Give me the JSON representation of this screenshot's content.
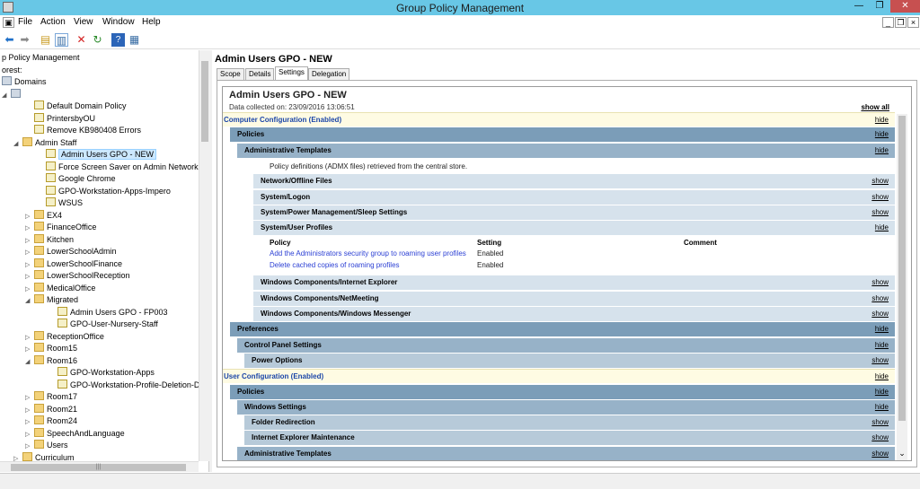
{
  "window": {
    "title": "Group Policy Management"
  },
  "menu": [
    "File",
    "Action",
    "View",
    "Window",
    "Help"
  ],
  "tree": {
    "nodes": [
      {
        "label": "p Policy Management",
        "indent": 0,
        "icon": "none",
        "exp": ""
      },
      {
        "label": "orest:",
        "indent": 0,
        "icon": "none",
        "exp": ""
      },
      {
        "label": "Domains",
        "indent": 0,
        "icon": "domain",
        "exp": ""
      },
      {
        "label": "",
        "indent": 0,
        "icon": "domain",
        "exp": "◢"
      },
      {
        "label": "Default Domain Policy",
        "indent": 2,
        "icon": "gpo",
        "exp": ""
      },
      {
        "label": "PrintersbyOU",
        "indent": 2,
        "icon": "gpo",
        "exp": ""
      },
      {
        "label": "Remove KB980408 Errors",
        "indent": 2,
        "icon": "gpo",
        "exp": ""
      },
      {
        "label": "Admin Staff",
        "indent": 1,
        "icon": "folder",
        "exp": "◢"
      },
      {
        "label": "Admin Users GPO - NEW",
        "indent": 3,
        "icon": "gpo",
        "exp": "",
        "selected": true
      },
      {
        "label": "Force Screen Saver on Admin Network",
        "indent": 3,
        "icon": "gpo",
        "exp": ""
      },
      {
        "label": "Google Chrome",
        "indent": 3,
        "icon": "gpo",
        "exp": ""
      },
      {
        "label": "GPO-Workstation-Apps-Impero",
        "indent": 3,
        "icon": "gpo",
        "exp": ""
      },
      {
        "label": "WSUS",
        "indent": 3,
        "icon": "gpo",
        "exp": ""
      },
      {
        "label": "EX4",
        "indent": 2,
        "icon": "folder",
        "exp": "▷"
      },
      {
        "label": "FinanceOffice",
        "indent": 2,
        "icon": "folder",
        "exp": "▷"
      },
      {
        "label": "Kitchen",
        "indent": 2,
        "icon": "folder",
        "exp": "▷"
      },
      {
        "label": "LowerSchoolAdmin",
        "indent": 2,
        "icon": "folder",
        "exp": "▷"
      },
      {
        "label": "LowerSchoolFinance",
        "indent": 2,
        "icon": "folder",
        "exp": "▷"
      },
      {
        "label": "LowerSchoolReception",
        "indent": 2,
        "icon": "folder",
        "exp": "▷"
      },
      {
        "label": "MedicalOffice",
        "indent": 2,
        "icon": "folder",
        "exp": "▷"
      },
      {
        "label": "Migrated",
        "indent": 2,
        "icon": "folder",
        "exp": "◢"
      },
      {
        "label": "Admin Users GPO - FP003",
        "indent": 4,
        "icon": "gpo",
        "exp": ""
      },
      {
        "label": "GPO-User-Nursery-Staff",
        "indent": 4,
        "icon": "gpo",
        "exp": ""
      },
      {
        "label": "ReceptionOffice",
        "indent": 2,
        "icon": "folder",
        "exp": "▷"
      },
      {
        "label": "Room15",
        "indent": 2,
        "icon": "folder",
        "exp": "▷"
      },
      {
        "label": "Room16",
        "indent": 2,
        "icon": "folder",
        "exp": "◢"
      },
      {
        "label": "GPO-Workstation-Apps",
        "indent": 4,
        "icon": "gpo",
        "exp": ""
      },
      {
        "label": "GPO-Workstation-Profile-Deletion-Dis",
        "indent": 4,
        "icon": "gpo",
        "exp": ""
      },
      {
        "label": "Room17",
        "indent": 2,
        "icon": "folder",
        "exp": "▷"
      },
      {
        "label": "Room21",
        "indent": 2,
        "icon": "folder",
        "exp": "▷"
      },
      {
        "label": "Room24",
        "indent": 2,
        "icon": "folder",
        "exp": "▷"
      },
      {
        "label": "SpeechAndLanguage",
        "indent": 2,
        "icon": "folder",
        "exp": "▷"
      },
      {
        "label": "Users",
        "indent": 2,
        "icon": "folder",
        "exp": "▷"
      },
      {
        "label": "Curriculum",
        "indent": 1,
        "icon": "folder",
        "exp": "▷"
      }
    ]
  },
  "right": {
    "title": "Admin Users GPO - NEW",
    "tabs": [
      "Scope",
      "Details",
      "Settings",
      "Delegation"
    ],
    "active_tab": "Settings"
  },
  "report": {
    "title": "Admin Users GPO - NEW",
    "date": "Data collected on: 23/09/2016 13:06:51",
    "show_all": "show all",
    "rows": [
      {
        "label": "Computer Configuration (Enabled)",
        "style": "cfg",
        "indent": 0,
        "action": "hide"
      },
      {
        "label": "Policies",
        "style": "lvl1",
        "indent": 8,
        "action": "hide"
      },
      {
        "label": "Administrative Templates",
        "style": "lvl2",
        "indent": 16,
        "action": "hide"
      },
      {
        "label": "Policy definitions (ADMX files) retrieved from the central store.",
        "style": "note",
        "indent": 52,
        "action": ""
      },
      {
        "label": "Network/Offline Files",
        "style": "lvl4",
        "indent": 34,
        "action": "show"
      },
      {
        "label": "System/Logon",
        "style": "lvl4",
        "indent": 34,
        "action": "show"
      },
      {
        "label": "System/Power Management/Sleep Settings",
        "style": "lvl4",
        "indent": 34,
        "action": "show"
      },
      {
        "label": "System/User Profiles",
        "style": "lvl4",
        "indent": 34,
        "action": "hide"
      },
      {
        "label": "Windows Components/Internet Explorer",
        "style": "lvl4",
        "indent": 34,
        "action": "show"
      },
      {
        "label": "Windows Components/NetMeeting",
        "style": "lvl4",
        "indent": 34,
        "action": "show"
      },
      {
        "label": "Windows Components/Windows Messenger",
        "style": "lvl4",
        "indent": 34,
        "action": "show"
      },
      {
        "label": "Preferences",
        "style": "lvl1",
        "indent": 8,
        "action": "hide"
      },
      {
        "label": "Control Panel Settings",
        "style": "lvl2",
        "indent": 16,
        "action": "hide"
      },
      {
        "label": "Power Options",
        "style": "lvl3",
        "indent": 24,
        "action": "show"
      },
      {
        "label": "User Configuration (Enabled)",
        "style": "cfg",
        "indent": 0,
        "action": "hide"
      },
      {
        "label": "Policies",
        "style": "lvl1",
        "indent": 8,
        "action": "hide"
      },
      {
        "label": "Windows Settings",
        "style": "lvl2",
        "indent": 16,
        "action": "hide"
      },
      {
        "label": "Folder Redirection",
        "style": "lvl3",
        "indent": 24,
        "action": "show"
      },
      {
        "label": "Internet Explorer Maintenance",
        "style": "lvl3",
        "indent": 24,
        "action": "show"
      },
      {
        "label": "Administrative Templates",
        "style": "lvl2",
        "indent": 16,
        "action": "show"
      }
    ],
    "policy_table": {
      "headers": [
        "Policy",
        "Setting",
        "Comment"
      ],
      "rows": [
        [
          "Add the Administrators security group to roaming user profiles",
          "Enabled",
          ""
        ],
        [
          "Delete cached copies of roaming profiles",
          "Enabled",
          ""
        ]
      ]
    }
  },
  "colors": {
    "titlebar": "#68c7e6",
    "computer_config_bg": "#fefbe3",
    "link": "#2b3fd4"
  }
}
